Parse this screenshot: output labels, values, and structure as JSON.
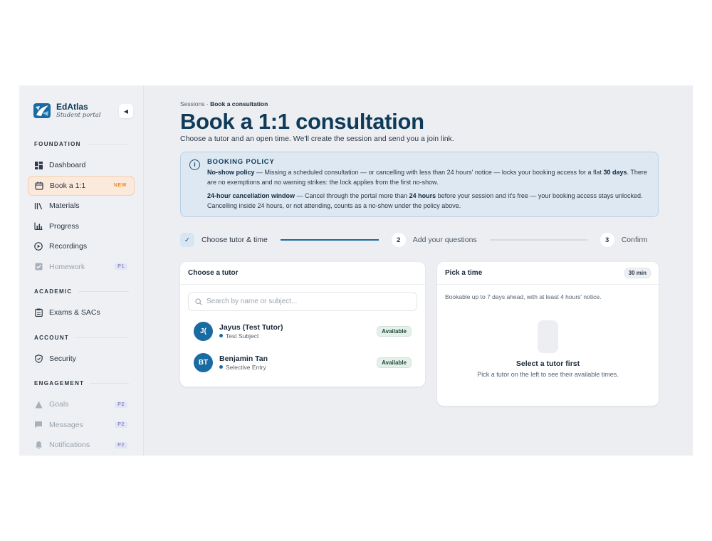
{
  "brand": {
    "name": "EdAtlas",
    "subtitle": "Student portal"
  },
  "sidebar": {
    "sections": [
      {
        "title": "FOUNDATION"
      },
      {
        "title": "ACADEMIC"
      },
      {
        "title": "ACCOUNT"
      },
      {
        "title": "ENGAGEMENT"
      }
    ],
    "items": {
      "dashboard": {
        "label": "Dashboard",
        "icon": "grid-icon"
      },
      "book": {
        "label": "Book a 1:1",
        "tag": "NEW",
        "icon": "calendar-icon"
      },
      "materials": {
        "label": "Materials",
        "icon": "library-icon"
      },
      "progress": {
        "label": "Progress",
        "icon": "bar-chart-icon"
      },
      "recordings": {
        "label": "Recordings",
        "icon": "play-circle-icon"
      },
      "homework": {
        "label": "Homework",
        "tag": "P1",
        "icon": "checkbox-icon"
      },
      "exams": {
        "label": "Exams & SACs",
        "icon": "clipboard-icon"
      },
      "security": {
        "label": "Security",
        "icon": "shield-icon"
      },
      "goals": {
        "label": "Goals",
        "tag": "P2",
        "icon": "goal-icon"
      },
      "messages": {
        "label": "Messages",
        "tag": "P2",
        "icon": "message-icon"
      },
      "notifications": {
        "label": "Notifications",
        "tag": "P2",
        "icon": "bell-icon"
      }
    }
  },
  "breadcrumb": {
    "parent": "Sessions",
    "separator": "·",
    "current": "Book a consultation"
  },
  "page": {
    "title": "Book a 1:1 consultation",
    "subtitle": "Choose a tutor and an open time. We'll create the session and send you a join link."
  },
  "policy": {
    "title": "BOOKING POLICY",
    "p1": {
      "bold1": "No-show policy",
      "text1": " — Missing a scheduled consultation — or cancelling with less than 24 hours' notice — locks your booking access for a flat ",
      "bold2": "30 days",
      "text2": ". There are no exemptions and no warning strikes: the lock applies from the first no-show."
    },
    "p2": {
      "bold1": "24-hour cancellation window",
      "text1": " — Cancel through the portal more than ",
      "bold2": "24 hours",
      "text2": " before your session and it's free — your booking access stays unlocked. Cancelling inside 24 hours, or not attending, counts as a no-show under the policy above."
    }
  },
  "stepper": {
    "steps": [
      {
        "label": "Choose tutor & time",
        "status": "done",
        "number": "✓"
      },
      {
        "label": "Add your questions",
        "status": "pending",
        "number": "2"
      },
      {
        "label": "Confirm",
        "status": "pending",
        "number": "3"
      }
    ]
  },
  "tutor_card": {
    "title": "Choose a tutor",
    "search_placeholder": "Search by name or subject...",
    "tutors": [
      {
        "initials": "J(",
        "name": "Jayus (Test Tutor)",
        "subject": "Test Subject",
        "status": "Available"
      },
      {
        "initials": "BT",
        "name": "Benjamin Tan",
        "subject": "Selective Entry",
        "status": "Available"
      }
    ]
  },
  "time_card": {
    "title": "Pick a time",
    "duration": "30 min",
    "note": "Bookable up to 7 days ahead, with at least 4 hours' notice.",
    "empty_title": "Select a tutor first",
    "empty_sub": "Pick a tutor on the left to see their available times."
  },
  "colors": {
    "accent": "#0f3a58",
    "avatar": "#1a6ba3",
    "new_tag": "#f08a24",
    "active_bg": "#fbe9dc"
  }
}
